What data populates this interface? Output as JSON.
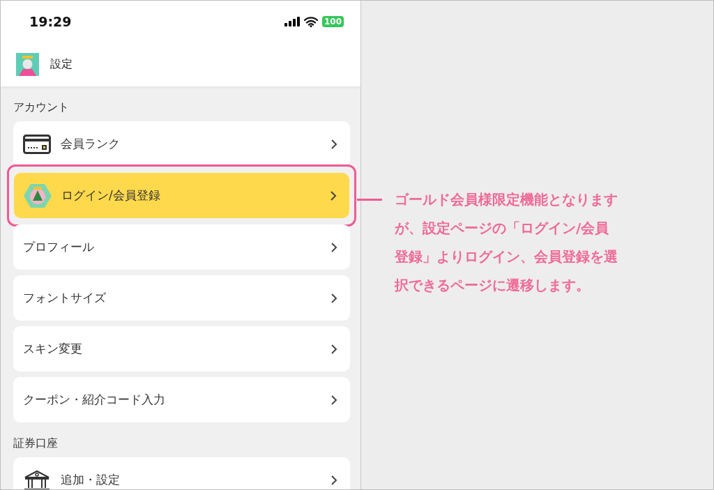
{
  "status_bar": {
    "time": "19:29",
    "battery": "100"
  },
  "header": {
    "title": "設定"
  },
  "sections": [
    {
      "title": "アカウント",
      "items": [
        {
          "label": "会員ランク",
          "kind": "card",
          "selected": false
        },
        {
          "label": "ログイン/会員登録",
          "kind": "mascot",
          "selected": true
        },
        {
          "label": "プロフィール",
          "kind": "plain",
          "selected": false
        },
        {
          "label": "フォントサイズ",
          "kind": "plain",
          "selected": false
        },
        {
          "label": "スキン変更",
          "kind": "plain",
          "selected": false
        },
        {
          "label": "クーポン・紹介コード入力",
          "kind": "plain",
          "selected": false
        }
      ]
    },
    {
      "title": "証券口座",
      "items": [
        {
          "label": "追加・設定",
          "kind": "bank",
          "selected": false
        }
      ]
    }
  ],
  "annotation": {
    "lines": [
      "ゴールド会員様限定機能となります",
      "が、設定ページの「ログイン/会員",
      "登録」よりログイン、会員登録を選",
      "択できるページに遷移します。"
    ]
  }
}
